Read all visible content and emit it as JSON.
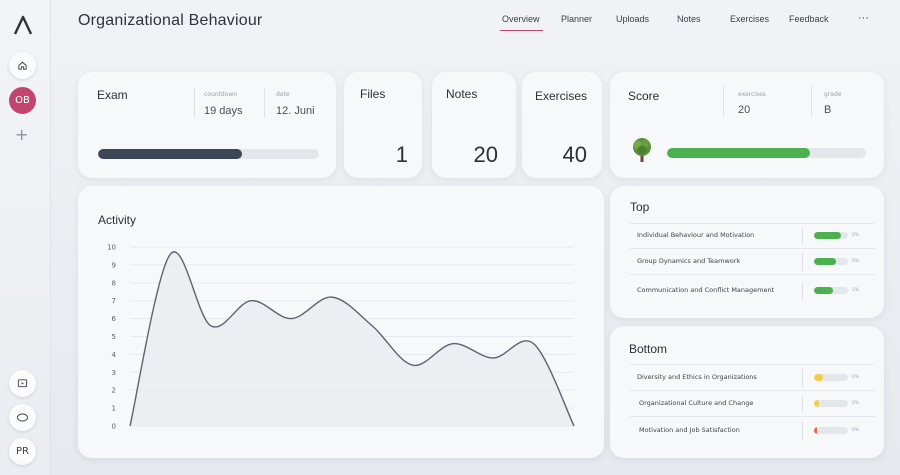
{
  "app": {
    "title": "Organizational Behaviour"
  },
  "sidebar": {
    "course_badge": "OB",
    "user_badge": "PR",
    "plus": "+",
    "icons": [
      "logo-icon",
      "home-icon",
      "plus-icon",
      "slides-icon",
      "oval-icon"
    ]
  },
  "nav": {
    "items": [
      "Overview",
      "Planner",
      "Uploads",
      "Notes",
      "Exercises",
      "Feedback"
    ],
    "more": "···",
    "active": "Overview"
  },
  "exam": {
    "title": "Exam",
    "countdown_label": "countdown",
    "countdown_value": "19 days",
    "date_label": "date",
    "date_value": "12. Juni",
    "progress": 0.65
  },
  "files": {
    "title": "Files",
    "value": "1"
  },
  "notes": {
    "title": "Notes",
    "value": "20"
  },
  "exercises": {
    "title": "Exercises",
    "value": "40"
  },
  "score": {
    "title": "Score",
    "exercises_label": "exercises",
    "exercises_value": "20",
    "grade_label": "grade",
    "grade_value": "B",
    "progress": 0.72,
    "icon": "tree-icon"
  },
  "activity": {
    "title": "Activity"
  },
  "top": {
    "title": "Top",
    "items": [
      {
        "label": "Individual Behaviour and Motivation",
        "pct": "0%",
        "fill": 0.8,
        "color": "#4caf50"
      },
      {
        "label": "Group Dynamics and Teamwork",
        "pct": "0%",
        "fill": 0.65,
        "color": "#4caf50"
      },
      {
        "label": "Communication and Conflict Management",
        "pct": "1%",
        "fill": 0.55,
        "color": "#4caf50"
      }
    ]
  },
  "bottom": {
    "title": "Bottom",
    "items": [
      {
        "label": "Diversity and Ethics in Organizations",
        "pct": "0%",
        "fill": 0.25,
        "color": "#f2cc4a"
      },
      {
        "label": "Organizational Culture and Change",
        "pct": "0%",
        "fill": 0.15,
        "color": "#f2cc4a"
      },
      {
        "label": "Motivation and Job Satisfaction",
        "pct": "0%",
        "fill": 0.08,
        "color": "#e76a4a"
      }
    ]
  },
  "colors": {
    "accent": "#c2456e",
    "exam_bar": "#3b4656",
    "score_bar": "#4caf50"
  },
  "chart_data": {
    "type": "area",
    "title": "Activity",
    "xlabel": "",
    "ylabel": "",
    "ylim": [
      0,
      10
    ],
    "yticks": [
      0,
      1,
      2,
      3,
      4,
      5,
      6,
      7,
      8,
      9,
      10
    ],
    "grid": true,
    "series": [
      {
        "values": [
          0,
          9.6,
          5.6,
          7.0,
          6.0,
          7.2,
          5.6,
          3.4,
          4.6,
          3.8,
          4.6,
          0
        ]
      }
    ]
  }
}
